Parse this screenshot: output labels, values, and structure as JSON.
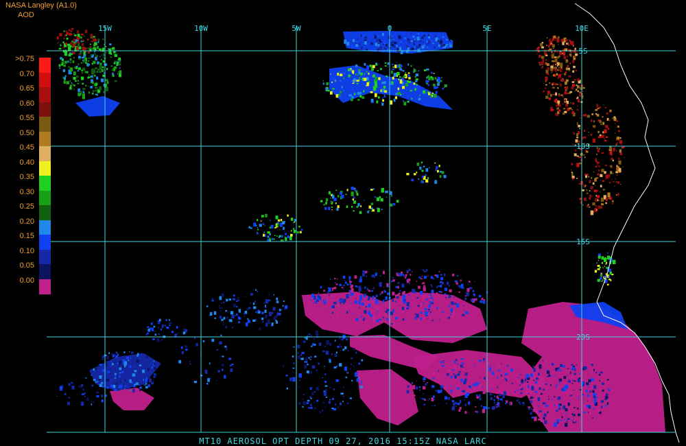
{
  "header": {
    "source": "NASA Langley (A1.0)",
    "unit": "AOD"
  },
  "colorbar": [
    {
      "label": ">0.75",
      "color": "#ff1a1a"
    },
    {
      "label": "0.70",
      "color": "#d01010"
    },
    {
      "label": "0.65",
      "color": "#a81010"
    },
    {
      "label": "0.60",
      "color": "#801010"
    },
    {
      "label": "0.55",
      "color": "#7a5a10"
    },
    {
      "label": "0.50",
      "color": "#b07a20"
    },
    {
      "label": "0.45",
      "color": "#e0b060"
    },
    {
      "label": "0.40",
      "color": "#f0f020"
    },
    {
      "label": "0.35",
      "color": "#20d020"
    },
    {
      "label": "0.30",
      "color": "#18a018"
    },
    {
      "label": "0.25",
      "color": "#106010"
    },
    {
      "label": "0.20",
      "color": "#2088e8"
    },
    {
      "label": "0.15",
      "color": "#1040f0"
    },
    {
      "label": "0.10",
      "color": "#1428a8"
    },
    {
      "label": "0.05",
      "color": "#0c1460"
    },
    {
      "label": "0.00",
      "color": "#c0208c"
    }
  ],
  "grid": {
    "lon_labels": [
      "15W",
      "10W",
      "5W",
      "0",
      "5E",
      "10E"
    ],
    "lat_labels": [
      "5S",
      "10S",
      "15S",
      "20S"
    ],
    "color": "#40d8e0"
  },
  "footer": "MT10  AEROSOL OPT DEPTH   09 27, 2016 15:15Z   NASA LARC"
}
